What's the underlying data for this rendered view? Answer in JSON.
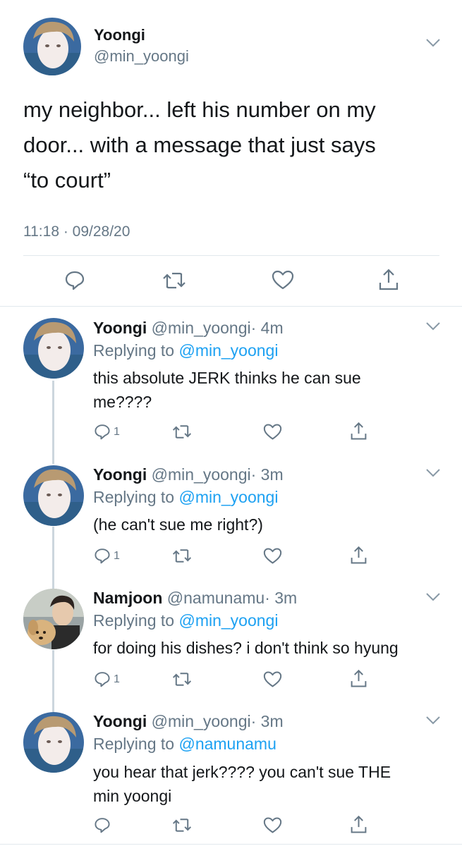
{
  "main_tweet": {
    "author_name": "Yoongi",
    "author_handle": "@min_yoongi",
    "text_line1": "my neighbor... left his number on my",
    "text_line2": "door... with a message that just says",
    "text_line3": "“to court”",
    "timestamp": "11:18 · 09/28/20",
    "actions": [
      "reply-icon",
      "retweet-icon",
      "like-icon",
      "share-icon"
    ]
  },
  "replies": [
    {
      "author_name": "Yoongi",
      "author_handle": "@min_yoongi",
      "time": "· 4m",
      "replying_prefix": "Replying to ",
      "replying_to": "@min_yoongi",
      "text_line1": "this absolute JERK thinks he can sue",
      "text_line2": "me????",
      "reply_count": "1"
    },
    {
      "author_name": "Yoongi",
      "author_handle": "@min_yoongi",
      "time": "· 3m",
      "replying_prefix": "Replying to ",
      "replying_to": "@min_yoongi",
      "text_line1": "(he can't sue me right?)",
      "reply_count": "1"
    },
    {
      "author_name": "Namjoon",
      "author_handle": "@namunamu",
      "time": "· 3m",
      "replying_prefix": "Replying to ",
      "replying_to": "@min_yoongi",
      "text_line1": "for doing his dishes? i don't think so hyung",
      "reply_count": "1"
    },
    {
      "author_name": "Yoongi",
      "author_handle": "@min_yoongi",
      "time": "· 3m",
      "replying_prefix": "Replying to ",
      "replying_to": "@namunamu",
      "text_line1": "you hear that jerk???? you can't sue THE",
      "text_line2": "min yoongi"
    }
  ],
  "colors": {
    "text": "#14171a",
    "secondary": "#657786",
    "link": "#1da1f2",
    "divider": "#e1e8ed",
    "thread_line": "#ccd6dd"
  }
}
